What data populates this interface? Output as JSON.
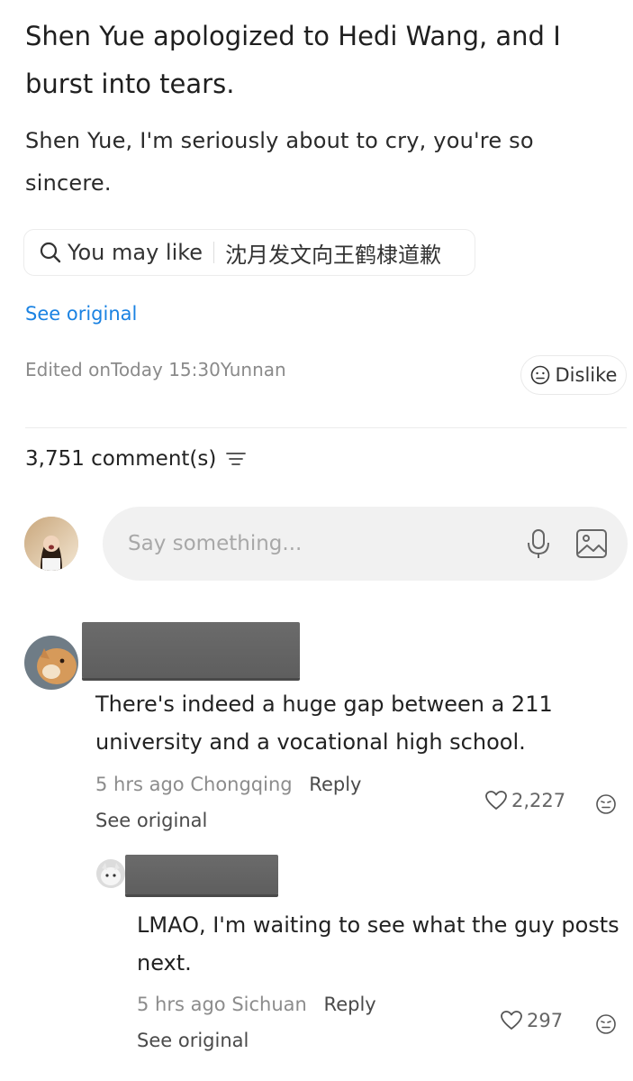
{
  "post": {
    "title": "Shen Yue apologized to Hedi Wang, and I burst into tears.",
    "body": "Shen Yue, I'm seriously about to cry, you're so sincere.",
    "you_may_like_label": "You may like",
    "you_may_like_query": "沈月发文向王鹤棣道歉",
    "see_original": "See original",
    "edited_meta": "Edited onToday 15:30Yunnan",
    "dislike_label": "Dislike"
  },
  "comments_header": {
    "count_text": "3,751 comment(s)",
    "input_placeholder": "Say something..."
  },
  "comments": [
    {
      "text": "There's indeed a huge gap between a 211 university and a vocational high school.",
      "time": "5 hrs ago",
      "location": "Chongqing",
      "reply_label": "Reply",
      "likes": "2,227",
      "see_original": "See original"
    },
    {
      "text": "LMAO, I'm waiting to see what the guy posts next.",
      "time": "5 hrs ago",
      "location": "Sichuan",
      "reply_label": "Reply",
      "likes": "297",
      "see_original": "See original"
    }
  ],
  "icons": {
    "search": "search-icon",
    "dislike": "dislike-face-icon",
    "sort": "sort-filter-icon",
    "mic": "microphone-icon",
    "image": "image-icon",
    "heart": "heart-icon",
    "face": "emoji-face-icon"
  },
  "colors": {
    "link_blue": "#1a82e2",
    "input_bg": "#f1f1f1",
    "muted_text": "#8a8a8a"
  }
}
